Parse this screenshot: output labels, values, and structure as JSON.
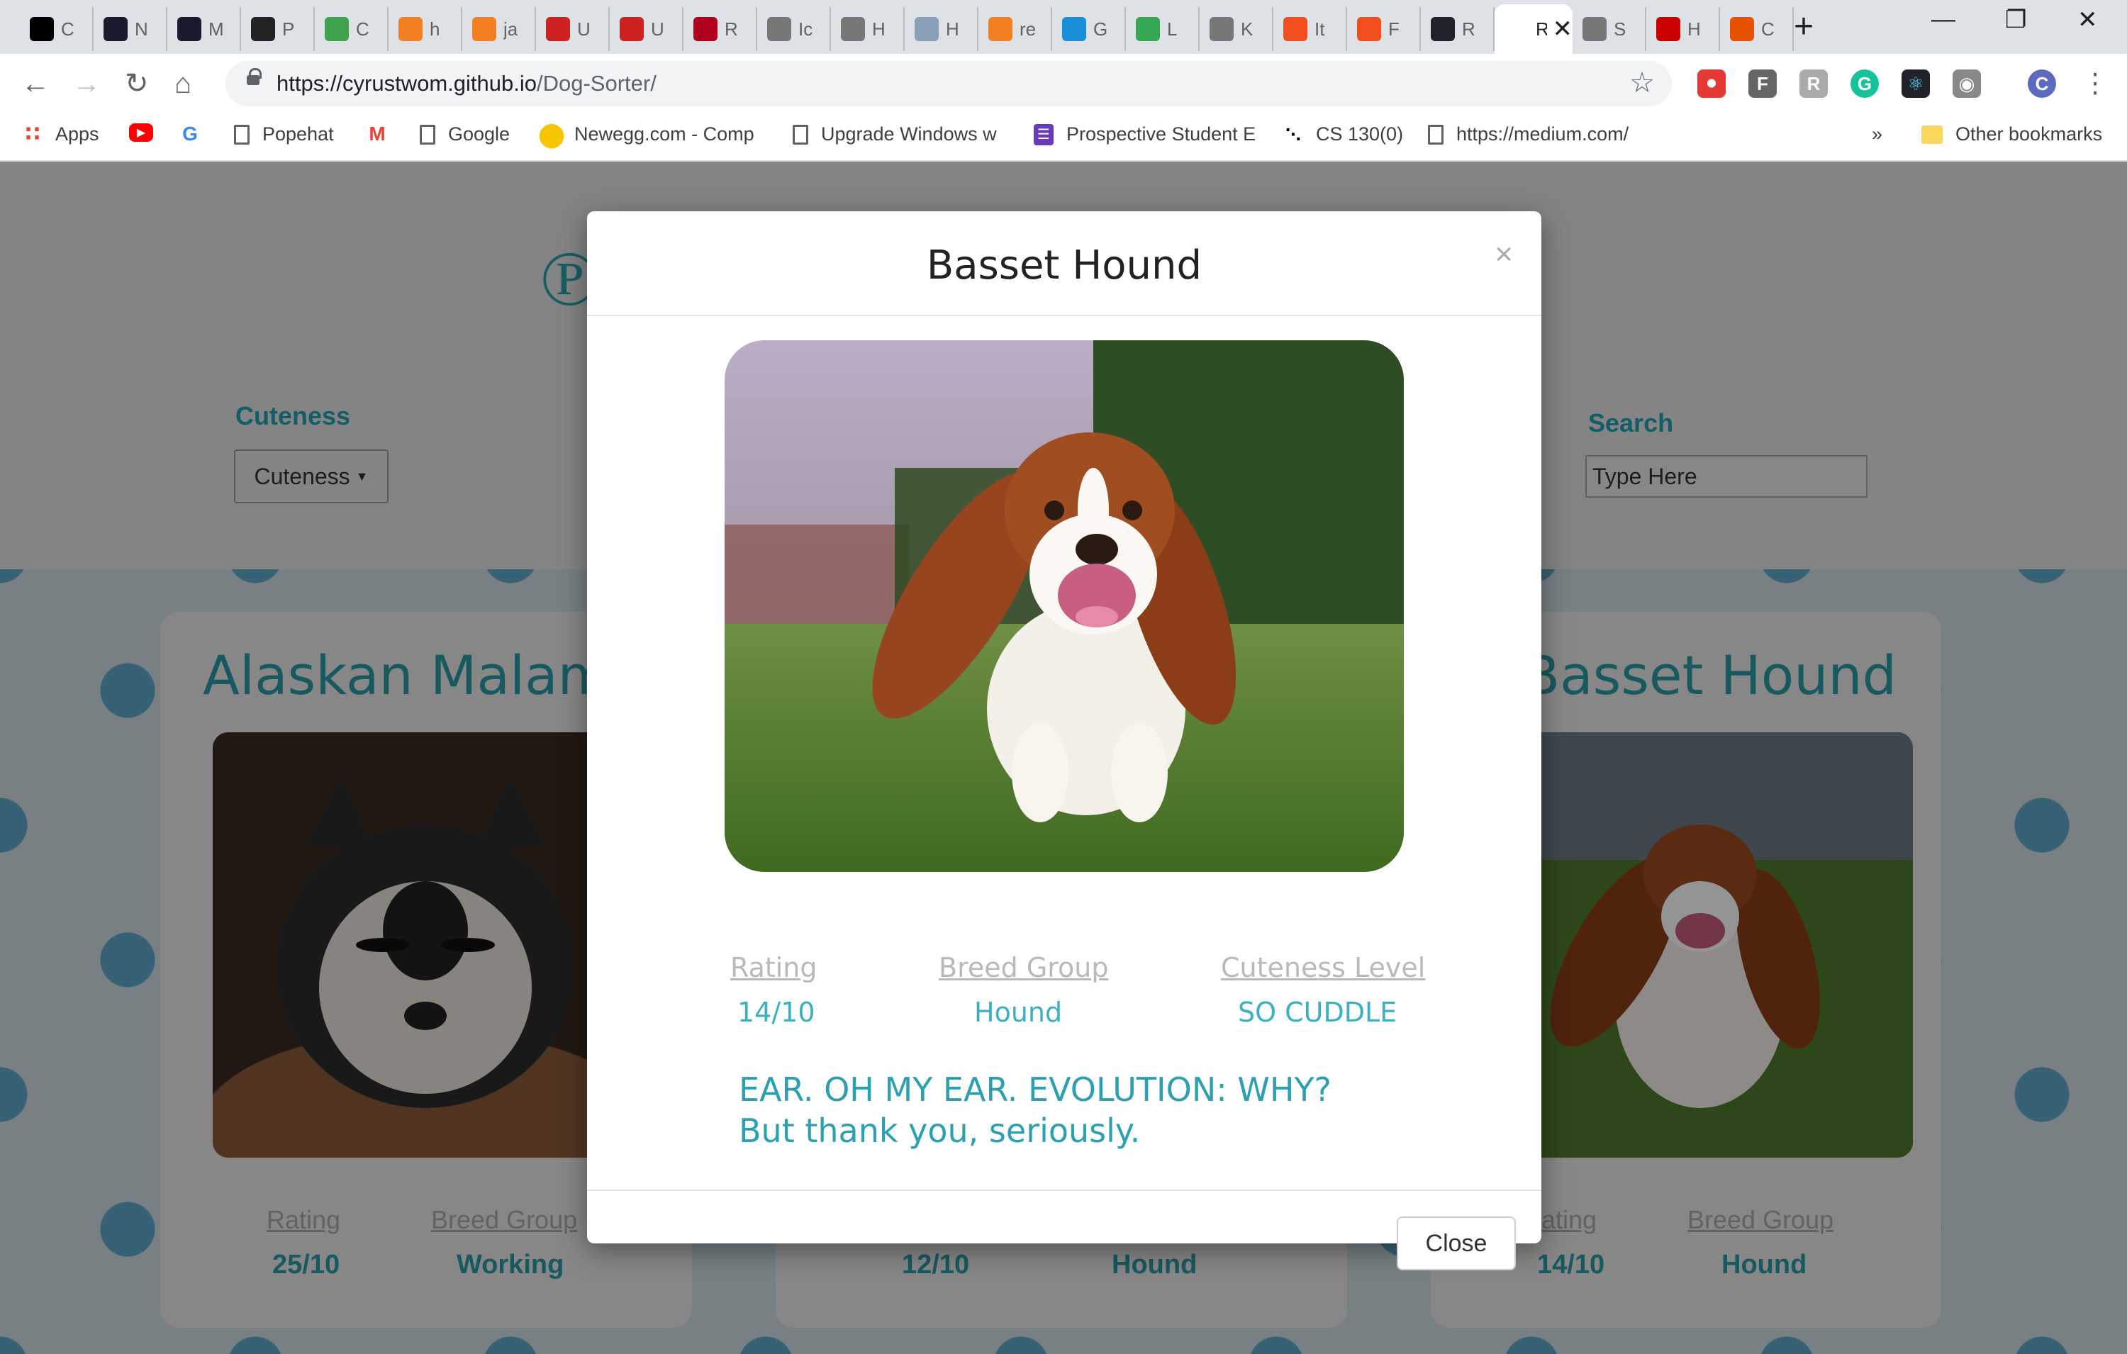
{
  "browser": {
    "tabs": [
      {
        "abbr": "C",
        "color": "#000000"
      },
      {
        "abbr": "N",
        "color": "#1a1a2e"
      },
      {
        "abbr": "M",
        "color": "#1a1a2e"
      },
      {
        "abbr": "P",
        "color": "#222222"
      },
      {
        "abbr": "C",
        "color": "#3fa34d"
      },
      {
        "abbr": "h",
        "color": "#f48024"
      },
      {
        "abbr": "ja",
        "color": "#f48024"
      },
      {
        "abbr": "U",
        "color": "#cc2222"
      },
      {
        "abbr": "U",
        "color": "#cc2222"
      },
      {
        "abbr": "R",
        "color": "#b00020"
      },
      {
        "abbr": "Ic",
        "color": "#777777"
      },
      {
        "abbr": "H",
        "color": "#777777"
      },
      {
        "abbr": "H",
        "color": "#8aa0b8"
      },
      {
        "abbr": "re",
        "color": "#f48024"
      },
      {
        "abbr": "G",
        "color": "#1a8fd8"
      },
      {
        "abbr": "L",
        "color": "#34a853"
      },
      {
        "abbr": "K",
        "color": "#777777"
      },
      {
        "abbr": "It",
        "color": "#f24e1e"
      },
      {
        "abbr": "F",
        "color": "#f24e1e"
      },
      {
        "abbr": "R",
        "color": "#20232a"
      },
      {
        "abbr": "Re",
        "color": "#ffffff",
        "active": true
      },
      {
        "abbr": "S",
        "color": "#777777"
      },
      {
        "abbr": "H",
        "color": "#cc0000"
      },
      {
        "abbr": "C",
        "color": "#e65100"
      }
    ],
    "url_host": "https://cyrustwom.github.io",
    "url_path": "/Dog-Sorter/",
    "bookmarks": {
      "apps": "Apps",
      "popehat": "Popehat",
      "google": "Google",
      "newegg": "Newegg.com - Comp",
      "upgrade": "Upgrade Windows w",
      "prospective": "Prospective Student E",
      "cs130": "CS 130(0)",
      "medium": "https://medium.com/",
      "more": "»",
      "other": "Other bookmarks"
    },
    "profile_initial": "C"
  },
  "page": {
    "cuteness_label": "Cuteness",
    "cuteness_dropdown": "Cuteness",
    "search_label": "Search",
    "search_placeholder": "Type Here",
    "cards": [
      {
        "title": "Alaskan Malamu",
        "rating_label": "Rating",
        "rating": "25/10",
        "group_label": "Breed Group",
        "group": "Working"
      },
      {
        "title": "",
        "rating_label": "",
        "rating": "12/10",
        "group_label": "",
        "group": "Hound"
      },
      {
        "title": "Basset Hound",
        "rating_label": "Rating",
        "rating": "14/10",
        "group_label": "Breed Group",
        "group": "Hound"
      }
    ]
  },
  "modal": {
    "title": "Basset Hound",
    "close_x": "×",
    "rating_label": "Rating",
    "rating": "14/10",
    "group_label": "Breed Group",
    "group": "Hound",
    "cuteness_label": "Cuteness Level",
    "cuteness": "SO CUDDLE",
    "description": "EAR. OH MY EAR. EVOLUTION: WHY? But thank you, seriously.",
    "close_button": "Close"
  }
}
